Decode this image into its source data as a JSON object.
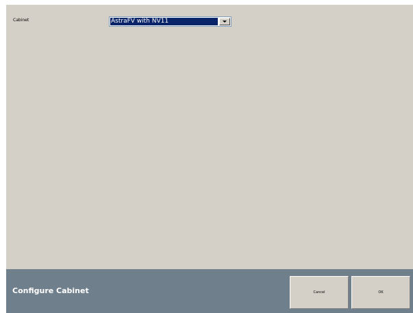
{
  "form": {
    "cabinet_label": "Cabinet",
    "cabinet_value": "AstraFV with NV11"
  },
  "footer": {
    "title": "Configure Cabinet",
    "cancel_label": "Cancel",
    "ok_label": "OK"
  },
  "colors": {
    "background": "#d4d0c8",
    "footer": "#6f7f8c",
    "selection": "#0a246a"
  },
  "icons": {
    "dropdown": "chevron-down-icon"
  }
}
